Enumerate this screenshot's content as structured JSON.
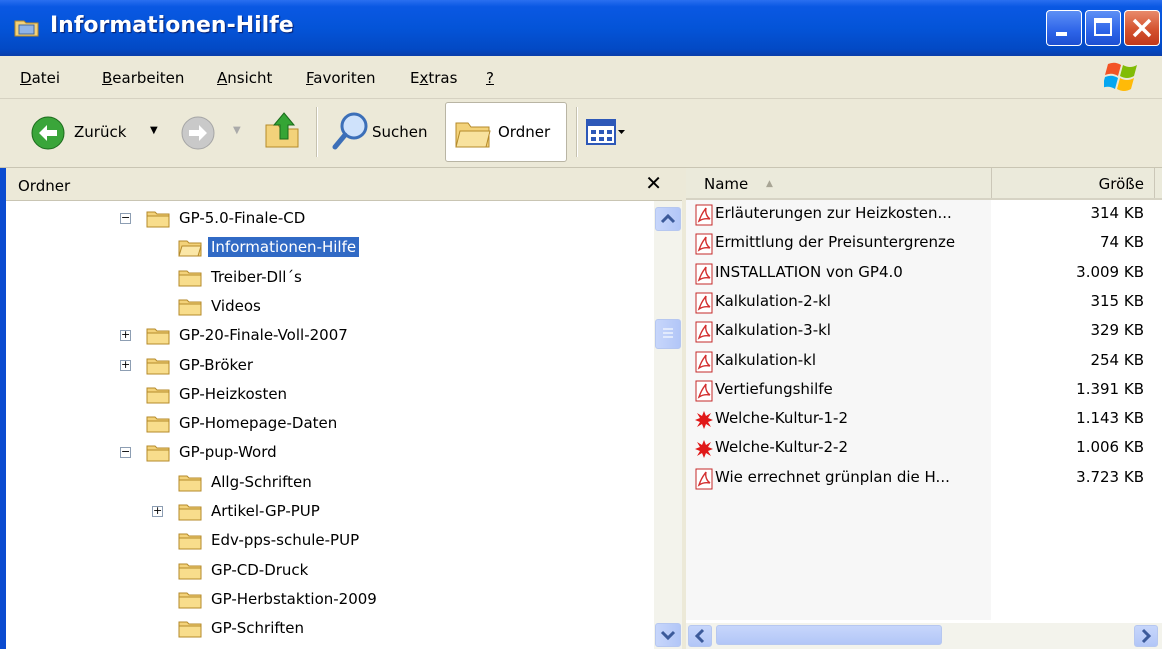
{
  "window": {
    "title": "Informationen-Hilfe"
  },
  "menu": [
    {
      "label": "Datei",
      "accel": "D",
      "rest": "atei"
    },
    {
      "label": "Bearbeiten",
      "accel": "B",
      "rest": "earbeiten"
    },
    {
      "label": "Ansicht",
      "accel": "A",
      "rest": "nsicht"
    },
    {
      "label": "Favoriten",
      "accel": "F",
      "rest": "avoriten"
    },
    {
      "label": "Extras",
      "pre": "E",
      "accel": "x",
      "rest": "tras"
    },
    {
      "label": "?",
      "accel": "?",
      "rest": ""
    }
  ],
  "toolbar": {
    "back_label": "Zurück",
    "search_label": "Suchen",
    "folders_label": "Ordner"
  },
  "folder_pane": {
    "header": "Ordner",
    "close_glyph": "✕"
  },
  "tree": [
    {
      "label": "GP-5.0-Finale-CD",
      "indent": 0,
      "expander": "−",
      "open": true
    },
    {
      "label": "Informationen-Hilfe",
      "indent": 1,
      "expander": null,
      "open": true,
      "selected": true
    },
    {
      "label": "Treiber-Dll´s",
      "indent": 1,
      "expander": null
    },
    {
      "label": "Videos",
      "indent": 1,
      "expander": null
    },
    {
      "label": "GP-20-Finale-Voll-2007",
      "indent": 0,
      "expander": "+"
    },
    {
      "label": "GP-Bröker",
      "indent": 0,
      "expander": "+"
    },
    {
      "label": "GP-Heizkosten",
      "indent": 0,
      "expander": null
    },
    {
      "label": "GP-Homepage-Daten",
      "indent": 0,
      "expander": null
    },
    {
      "label": "GP-pup-Word",
      "indent": 0,
      "expander": "−",
      "open": true
    },
    {
      "label": "Allg-Schriften",
      "indent": 1,
      "expander": null
    },
    {
      "label": "Artikel-GP-PUP",
      "indent": 1,
      "expander": "+"
    },
    {
      "label": "Edv-pps-schule-PUP",
      "indent": 1,
      "expander": null
    },
    {
      "label": "GP-CD-Druck",
      "indent": 1,
      "expander": null
    },
    {
      "label": "GP-Herbstaktion-2009",
      "indent": 1,
      "expander": null
    },
    {
      "label": "GP-Schriften",
      "indent": 1,
      "expander": null
    }
  ],
  "files": {
    "col_name": "Name",
    "col_size": "Größe",
    "items": [
      {
        "name": "Erläuterungen zur Heizkosten...",
        "size": "314 KB",
        "icon": "pdf-icon"
      },
      {
        "name": "Ermittlung der Preisuntergrenze",
        "size": "74 KB",
        "icon": "pdf-icon"
      },
      {
        "name": "INSTALLATION von GP4.0",
        "size": "3.009 KB",
        "icon": "pdf-icon"
      },
      {
        "name": "Kalkulation-2-kl",
        "size": "315 KB",
        "icon": "pdf-icon"
      },
      {
        "name": "Kalkulation-3-kl",
        "size": "329 KB",
        "icon": "pdf-icon"
      },
      {
        "name": "Kalkulation-kl",
        "size": "254 KB",
        "icon": "pdf-icon"
      },
      {
        "name": "Vertiefungshilfe",
        "size": "1.391 KB",
        "icon": "pdf-icon"
      },
      {
        "name": "Welche-Kultur-1-2",
        "size": "1.143 KB",
        "icon": "splat-icon"
      },
      {
        "name": "Welche-Kultur-2-2",
        "size": "1.006 KB",
        "icon": "splat-icon"
      },
      {
        "name": "Wie errechnet grünplan die H...",
        "size": "3.723 KB",
        "icon": "pdf-icon"
      }
    ]
  },
  "colors": {
    "titlebar": "#0454d8",
    "chrome": "#ece9d8",
    "selection": "#316ac5"
  }
}
